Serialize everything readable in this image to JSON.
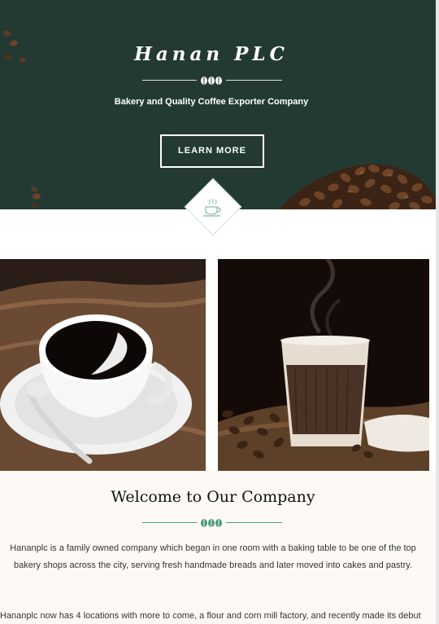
{
  "hero": {
    "title": "Hanan PLC",
    "subtitle": "Bakery and Quality Coffee Exporter Company",
    "cta_label": "LEARN MORE",
    "background_color": "#233a33"
  },
  "icons": {
    "divider": "coffee-beans-icon",
    "badge": "coffee-cup-icon"
  },
  "welcome": {
    "title": "Welcome to Our Company",
    "paragraph1": "Hananplc is a family owned company which began in one room with a baking table to be one of the top bakery shops across the city, serving fresh handmade breads and later moved into cakes and pastry.",
    "paragraph2": "Hananplc now has 4 locations with more to come, a flour and corn mill factory, and recently made its debut",
    "accent_color": "#4a9a7d"
  }
}
